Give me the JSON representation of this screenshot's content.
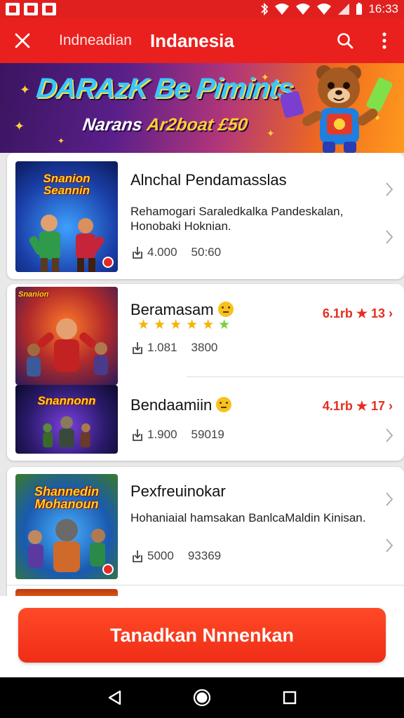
{
  "status_bar": {
    "time": "16:33"
  },
  "app_bar": {
    "subtitle": "Indneadian",
    "title": "Indanesia"
  },
  "banner": {
    "headline": "DARAzK Be Pimints",
    "sub_prefix": "Narans ",
    "sub_highlight": "Ar2boat £50"
  },
  "items": [
    {
      "thumb_title": "Snanion Seannin",
      "title": "Alnchal Pendamasslas",
      "description": "Rehamogari Saraledkalka Pandeskalan, Honobaki Hoknian.",
      "downloads": "4.000",
      "size": "50:60"
    },
    {
      "thumb_title": "Snanion",
      "title": "Beramasam",
      "stars": "★★★★★",
      "extra_star": "★",
      "rating": "6.1rb ★ 13 ›",
      "downloads": "1.081",
      "size": "3800"
    },
    {
      "thumb_title": "Snannonn",
      "title": "Bendaamiin",
      "rating": "4.1rb ★ 17 ›",
      "downloads": "1.900",
      "size": "59019"
    },
    {
      "thumb_title": "Shannedin Mohanoun",
      "title": "Pexfreuinokar",
      "description": "Hohaniaial hamsakan BanlcaMaldin Kinisan.",
      "downloads": "5000",
      "size": "93369"
    }
  ],
  "cta": {
    "label": "Tanadkan Nnnenkan"
  },
  "colors": {
    "brand_red": "#e9201e",
    "cta_orange": "#ff4a26",
    "rating_red": "#e3301f",
    "star_yellow": "#f4b400"
  }
}
